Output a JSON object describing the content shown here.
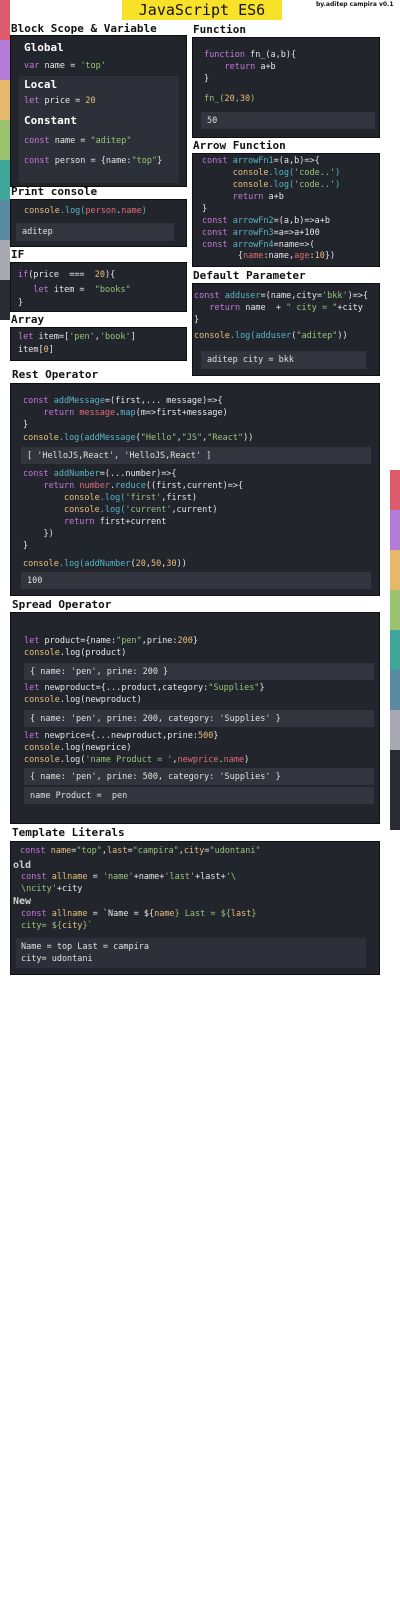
{
  "colors": {
    "left_strip": [
      "#e05a6d",
      "#b37cd6",
      "#e6b86b",
      "#9bc26f",
      "#3fa69a",
      "#5b8aa3",
      "#a8a8b3",
      "#2a2c33"
    ],
    "right_strip": [
      "#e05a6d",
      "#b37cd6",
      "#e6b86b",
      "#9bc26f",
      "#3fa69a",
      "#5b8aa3",
      "#a8a8b3",
      "#2a2c33"
    ],
    "title_bg": "#f7e229",
    "box_bg": "#23252d"
  },
  "title": "JavaScript ES6",
  "byline": "by.aditep campira v0.1",
  "sections": {
    "block_scope": {
      "heading": "Block Scope & Variable",
      "global_label": "Global",
      "global_code": [
        "var",
        " name = ",
        "'top'"
      ],
      "local_label": "Local",
      "local_code": [
        "let",
        " price = ",
        "20"
      ],
      "constant_label": "Constant",
      "const1": [
        "const",
        " name = ",
        "\"aditep\""
      ],
      "const2": [
        "const",
        " person = {name:",
        "\"top\"",
        "}"
      ]
    },
    "print_console": {
      "heading": "Print console",
      "code": [
        "console",
        ".log(",
        "person",
        ".",
        "name",
        ")"
      ],
      "output": "aditep"
    },
    "if": {
      "heading": "IF",
      "line1": [
        "if",
        "(price  ===  ",
        "20",
        "){"
      ],
      "line2": [
        "   ",
        "let",
        " item =  ",
        "\"books\""
      ],
      "line3": "}"
    },
    "array": {
      "heading": "Array",
      "line1": [
        "let",
        " item=[",
        "'pen'",
        ",",
        "'book'",
        "]"
      ],
      "line2": [
        "item[",
        "0",
        "]"
      ]
    },
    "function": {
      "heading": "Function",
      "line1": [
        "function",
        " fn_(a,b){"
      ],
      "line2": [
        "    ",
        "return",
        " a+b"
      ],
      "line3": "}",
      "call": [
        "fn_(",
        "20",
        ",",
        "30",
        ")"
      ],
      "output": "50"
    },
    "arrow": {
      "heading": "Arrow Function",
      "l1": [
        "const",
        " arrowFn1",
        "=(a,b)=>{"
      ],
      "l2": [
        "      ",
        "console",
        ".log(",
        "'code..'",
        ")"
      ],
      "l3": [
        "      ",
        "console",
        ".log(",
        "'code..'",
        ")"
      ],
      "l4": [
        "      ",
        "return",
        " a+b"
      ],
      "l5": "}",
      "l6": [
        "const",
        " arrowFn2",
        "=(a,b)=>a+b"
      ],
      "l7": [
        "const",
        " arrowFn3",
        "=a=>a+100"
      ],
      "l8": [
        "const",
        " arrowFn4",
        "=name=>("
      ],
      "l9": [
        "       {",
        "name",
        ":name,",
        "age",
        ":",
        "10",
        "})"
      ]
    },
    "default_param": {
      "heading": "Default Parameter",
      "l1": [
        "const",
        " adduser",
        "=(name,city=",
        "'bkk'",
        ")=>{"
      ],
      "l2": [
        "   ",
        "return",
        " name  + ",
        "\" city = \"",
        "+city"
      ],
      "l3": "}",
      "l4": [
        "console",
        ".log(",
        "adduser",
        "(",
        "\"aditep\"",
        "))"
      ],
      "output": "aditep city = bkk"
    },
    "rest": {
      "heading": "Rest Operator",
      "l1": [
        "const",
        " addMessage",
        "=(first,... message)=>{"
      ],
      "l2": [
        "    ",
        "return",
        " ",
        "message",
        ".",
        "map",
        "(m=>first+message)"
      ],
      "l3": "}",
      "l4": [
        "console",
        ".log(",
        "addMessage",
        "(",
        "\"Hello\"",
        ",",
        "\"JS\"",
        ",",
        "\"React\"",
        "))"
      ],
      "out1": "[ 'HelloJS,React', 'HelloJS,React' ]",
      "l5": [
        "const",
        " addNumber",
        "=(...number)=>{"
      ],
      "l6": [
        "    ",
        "return",
        " ",
        "number",
        ".",
        "reduce",
        "((first,current)=>{"
      ],
      "l7": [
        "        ",
        "console",
        ".log(",
        "'first'",
        ",first)"
      ],
      "l8": [
        "        ",
        "console",
        ".log(",
        "'current'",
        ",current)"
      ],
      "l9": [
        "        ",
        "return",
        " first+current"
      ],
      "l10": "    })",
      "l11": "}",
      "l12": [
        "console",
        ".log(",
        "addNumber",
        "(",
        "20",
        ",",
        "50",
        ",",
        "30",
        "))"
      ],
      "out2": "100"
    },
    "spread": {
      "heading": "Spread Operator",
      "l1": [
        "let",
        " product={name:",
        "\"pen\"",
        ",prine:",
        "200",
        "}"
      ],
      "l2": [
        "console",
        ".log(product)"
      ],
      "out1": "{ name: 'pen', prine: 200 }",
      "l3": [
        "let",
        " newproduct={...product,category:",
        "\"Supplies\"",
        "}"
      ],
      "l4": [
        "console",
        ".log(newproduct)"
      ],
      "out2": "{ name: 'pen', prine: 200, category: 'Supplies' }",
      "l5": [
        "let",
        " newprice={...newproduct,prine:",
        "500",
        "}"
      ],
      "l6": [
        "console",
        ".log(newprice)"
      ],
      "l7": [
        "console",
        ".log(",
        "'name Product = '",
        ",",
        "newprice",
        ".",
        "name",
        ")"
      ],
      "out3": "{ name: 'pen', prine: 500, category: 'Supplies' }",
      "out4": "name Product =  pen"
    },
    "template": {
      "heading": "Template Literals",
      "l1": [
        "const",
        " ",
        "name",
        "=",
        "\"top\"",
        ",",
        "last",
        "=",
        "\"campira\"",
        ",",
        "city",
        "=",
        "\"udontani\""
      ],
      "old_label": "old",
      "l2": [
        "const",
        " ",
        "allname",
        " = ",
        "'name'",
        "+name+",
        "'last'",
        "+last+",
        "'\\"
      ],
      "l3": [
        "\\ncity'",
        "+city"
      ],
      "new_label": "New",
      "l4": [
        "const",
        " ",
        "allname",
        " = `Name = ${",
        "name",
        "} Last = ${",
        "last",
        "}"
      ],
      "l5": [
        "city= ${",
        "city",
        "}`"
      ],
      "out1": "Name = top Last = campira",
      "out2": "city= udontani"
    }
  }
}
